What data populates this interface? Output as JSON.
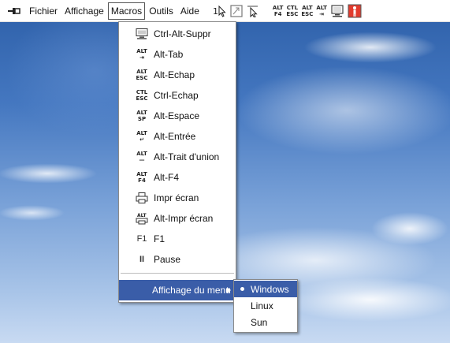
{
  "menubar": {
    "pin_icon": "pin-icon",
    "menus": [
      "Fichier",
      "Affichage",
      "Macros",
      "Outils",
      "Aide"
    ],
    "active_menu": "Macros",
    "toolbar": [
      {
        "name": "single-mouse-icon",
        "text": ""
      },
      {
        "name": "window-icon",
        "text": ""
      },
      {
        "name": "pointer-icon",
        "text": ""
      },
      {
        "name": "alt-f4-icon",
        "text": "ALT\nF4"
      },
      {
        "name": "ctrl-esc-icon",
        "text": "CTL\nESC"
      },
      {
        "name": "alt-esc-icon",
        "text": "ALT\nESC"
      },
      {
        "name": "alt-tab-icon",
        "text": "ALT\n⇥"
      },
      {
        "name": "monitor-icon",
        "text": ""
      },
      {
        "name": "person-exit-icon",
        "text": ""
      }
    ]
  },
  "dropdown": {
    "items": [
      {
        "label": "Ctrl-Alt-Suppr",
        "icon": "monitor-icon",
        "glyph": "🖵"
      },
      {
        "label": "Alt-Tab",
        "icon": "alt-tab-icon",
        "glyph": "ALT\n⇥"
      },
      {
        "label": "Alt-Echap",
        "icon": "alt-esc-icon",
        "glyph": "ALT\nESC"
      },
      {
        "label": "Ctrl-Echap",
        "icon": "ctrl-esc-icon",
        "glyph": "CTL\nESC"
      },
      {
        "label": "Alt-Espace",
        "icon": "alt-space-icon",
        "glyph": "ALT\nSP"
      },
      {
        "label": "Alt-Entrée",
        "icon": "alt-enter-icon",
        "glyph": "ALT\n↵"
      },
      {
        "label": "Alt-Trait d'union",
        "icon": "alt-hyphen-icon",
        "glyph": "ALT\n—"
      },
      {
        "label": "Alt-F4",
        "icon": "alt-f4-icon",
        "glyph": "ALT\nF4"
      },
      {
        "label": "Impr écran",
        "icon": "printer-icon",
        "glyph": "⎙"
      },
      {
        "label": "Alt-Impr écran",
        "icon": "alt-printer-icon",
        "glyph": "ALT\n⎙"
      },
      {
        "label": "F1",
        "icon": "f1-icon",
        "glyph": "F1"
      },
      {
        "label": "Pause",
        "icon": "pause-icon",
        "glyph": "II"
      }
    ],
    "submenu_label": "Affichage du menu"
  },
  "submenu": {
    "items": [
      "Windows",
      "Linux",
      "Sun"
    ],
    "selected": "Windows"
  },
  "colors": {
    "highlight": "#3a5da8",
    "menu_bg": "#ffffff"
  }
}
